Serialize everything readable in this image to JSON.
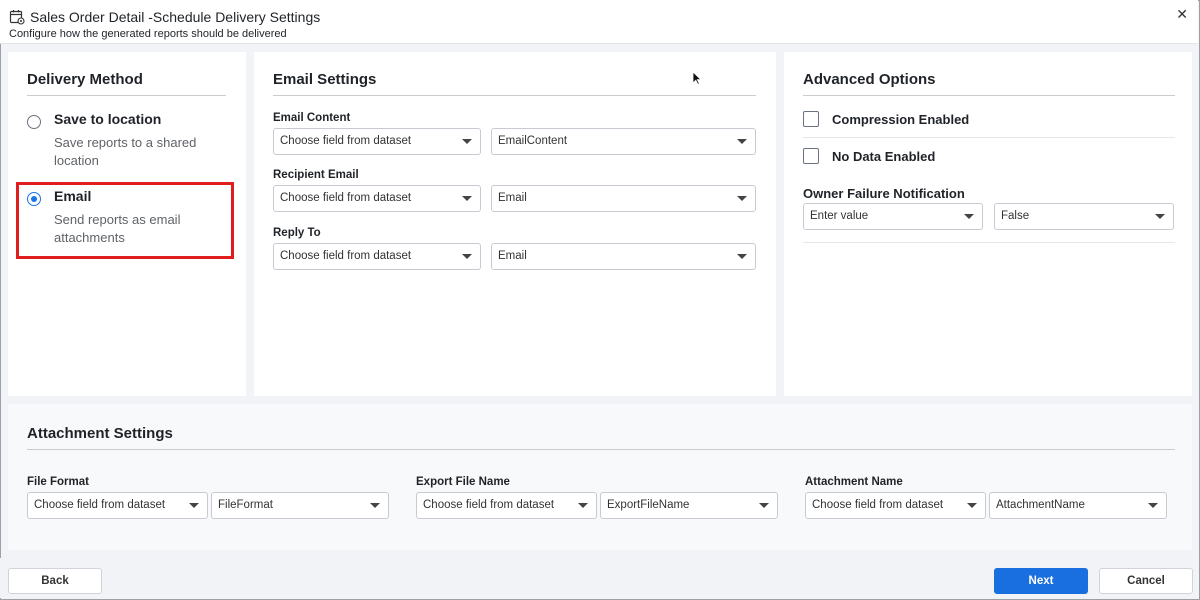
{
  "header": {
    "title": "Sales Order Detail -Schedule Delivery Settings",
    "subtitle": "Configure how the generated reports should be delivered",
    "close_glyph": "✕",
    "icon": "calendar-gear-icon"
  },
  "delivery": {
    "title": "Delivery Method",
    "options": [
      {
        "label": "Save to location",
        "desc": "Save reports to a shared location",
        "selected": false
      },
      {
        "label": "Email",
        "desc": "Send reports as email attachments",
        "selected": true
      }
    ]
  },
  "email": {
    "title": "Email Settings",
    "fields": [
      {
        "label": "Email Content",
        "source": "Choose field from dataset",
        "value": "EmailContent"
      },
      {
        "label": "Recipient Email",
        "source": "Choose field from dataset",
        "value": "Email"
      },
      {
        "label": "Reply To",
        "source": "Choose field from dataset",
        "value": "Email"
      }
    ]
  },
  "advanced": {
    "title": "Advanced Options",
    "compression_label": "Compression Enabled",
    "nodata_label": "No Data Enabled",
    "owner_label": "Owner Failure Notification",
    "owner_input": "Enter value",
    "owner_value": "False"
  },
  "attachment": {
    "title": "Attachment Settings",
    "fields": [
      {
        "label": "File Format",
        "source": "Choose field from dataset",
        "value": "FileFormat"
      },
      {
        "label": "Export File Name",
        "source": "Choose field from dataset",
        "value": "ExportFileName"
      },
      {
        "label": "Attachment Name",
        "source": "Choose field from dataset",
        "value": "AttachmentName"
      }
    ]
  },
  "footer": {
    "back_label": "Back",
    "next_label": "Next",
    "cancel_label": "Cancel"
  },
  "colors": {
    "accent": "#1a6fe0",
    "highlight": "#e01e1e"
  }
}
